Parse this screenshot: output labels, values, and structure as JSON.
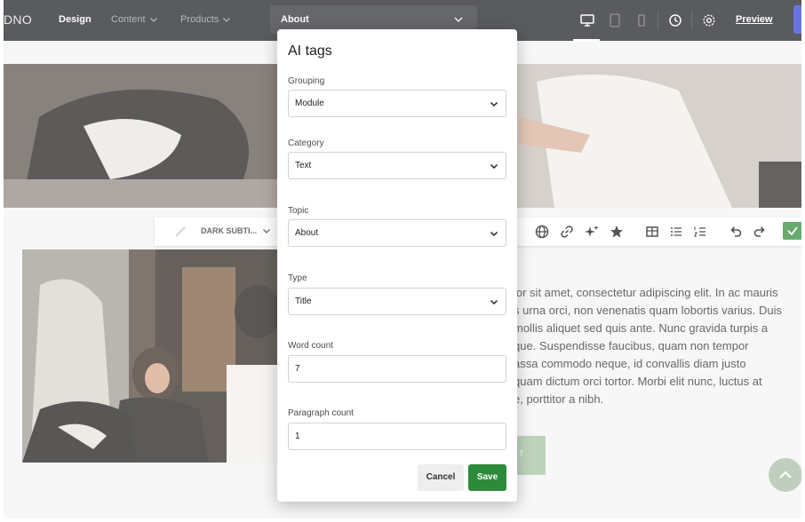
{
  "topbar": {
    "logo": "DNO",
    "nav": [
      {
        "label": "Design",
        "active": true
      },
      {
        "label": "Content",
        "active": false
      },
      {
        "label": "Products",
        "active": false
      }
    ],
    "page_select_value": "About",
    "device_icons": [
      "desktop-icon",
      "tablet-icon",
      "mobile-icon"
    ],
    "history_icon": "history-icon",
    "settings_icon": "gear-icon",
    "preview_label": "Preview"
  },
  "edit_toolbar": {
    "text_style": "DARK SUBTI...",
    "tools": [
      "globe-icon",
      "link-icon",
      "ai-sparkle-icon",
      "star-icon",
      "table-icon",
      "bullet-list-icon",
      "numbered-list-icon",
      "undo-icon",
      "redo-icon",
      "confirm-check-icon"
    ]
  },
  "content": {
    "body_lines": [
      "lor sit amet, consectetur adipiscing elit. In ac mauris",
      "s urna orci, non venenatis quam lobortis varius. Duis",
      "mollis aliquet sed quis ante. Nunc gravida turpis a",
      "que. Suspendisse faucibus, quam non tempor",
      "assa commodo neque, id convallis diam justo",
      "quam dictum orci tortor. Morbi elit nunc, luctus at",
      "e, porttitor a nibh."
    ],
    "cta_partial": "T"
  },
  "modal": {
    "title": "AI tags",
    "fields": [
      {
        "label": "Grouping",
        "value": "Module"
      },
      {
        "label": "Category",
        "value": "Text"
      },
      {
        "label": "Topic",
        "value": "About"
      },
      {
        "label": "Type",
        "value": "Title"
      },
      {
        "label": "Word count",
        "value": "7"
      },
      {
        "label": "Paragraph count",
        "value": "1"
      }
    ],
    "cancel_label": "Cancel",
    "save_label": "Save"
  },
  "colors": {
    "topbar_bg": "#1a1c20",
    "accent_green": "#2d8a3a",
    "publish_blue": "#2f41d9"
  }
}
